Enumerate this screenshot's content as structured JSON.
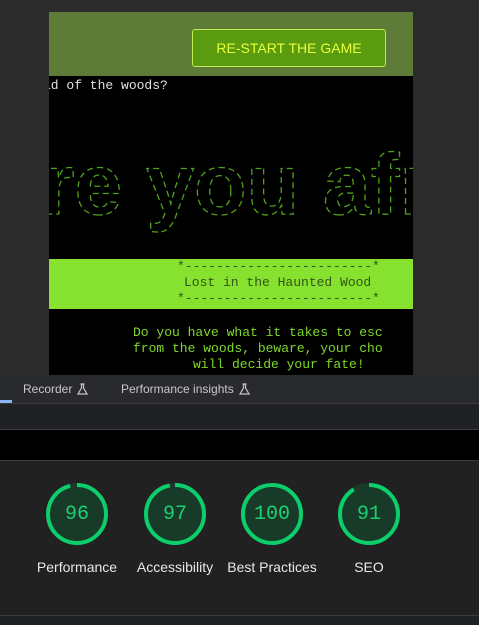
{
  "game": {
    "restart_label": "RE-START THE GAME",
    "question": "id of the woods?",
    "ascii_title": "re you afraid",
    "banner": {
      "border_top": "*------------------------*",
      "title": "Lost in the Haunted Wood",
      "border_bottom": "*------------------------*"
    },
    "story_lines": [
      "Do you have what it takes to esc",
      "from the woods, beware, your cho",
      "will decide your fate!"
    ]
  },
  "devtools": {
    "tabs": [
      {
        "label": "Recorder",
        "icon": "flask-icon"
      },
      {
        "label": "Performance insights",
        "icon": "flask-icon"
      }
    ],
    "scores": [
      {
        "score": "96",
        "label": "Performance",
        "fraction": 0.96
      },
      {
        "score": "97",
        "label": "Accessibility",
        "fraction": 0.97
      },
      {
        "score": "100",
        "label": "Best Practices",
        "fraction": 1.0
      },
      {
        "score": "91",
        "label": "SEO",
        "fraction": 0.91
      }
    ],
    "colors": {
      "pass": "#0cce6b",
      "pass_fill": "#183a28"
    }
  }
}
